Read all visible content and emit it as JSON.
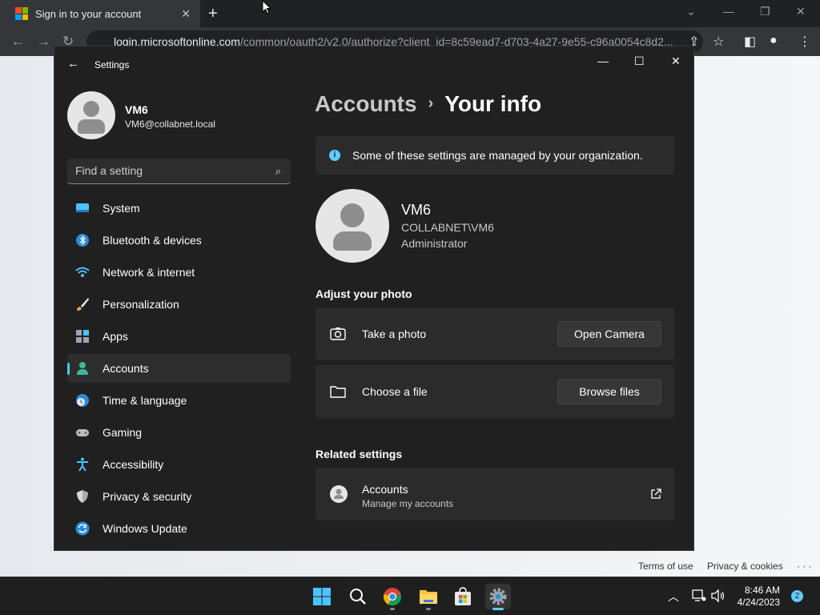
{
  "browser": {
    "tab_title": "Sign in to your account",
    "url_host": "login.microsoftonline.com",
    "url_path": "/common/oauth2/v2.0/authorize?client_id=8c59ead7-d703-4a27-9e55-c96a0054c8d2...",
    "footer_links": [
      "Terms of use",
      "Privacy & cookies",
      "· · ·"
    ]
  },
  "settings": {
    "window_title": "Settings",
    "profile": {
      "name": "VM6",
      "email": "VM6@collabnet.local"
    },
    "search_placeholder": "Find a setting",
    "nav": [
      {
        "label": "System",
        "icon": "system-icon"
      },
      {
        "label": "Bluetooth & devices",
        "icon": "bluetooth-icon"
      },
      {
        "label": "Network & internet",
        "icon": "wifi-icon"
      },
      {
        "label": "Personalization",
        "icon": "brush-icon"
      },
      {
        "label": "Apps",
        "icon": "apps-icon"
      },
      {
        "label": "Accounts",
        "icon": "accounts-icon",
        "active": true
      },
      {
        "label": "Time & language",
        "icon": "globe-clock-icon"
      },
      {
        "label": "Gaming",
        "icon": "gamepad-icon"
      },
      {
        "label": "Accessibility",
        "icon": "accessibility-icon"
      },
      {
        "label": "Privacy & security",
        "icon": "shield-icon"
      },
      {
        "label": "Windows Update",
        "icon": "update-icon"
      }
    ],
    "breadcrumb": {
      "parent": "Accounts",
      "separator": "›",
      "current": "Your info"
    },
    "banner": "Some of these settings are managed by your organization.",
    "user": {
      "name": "VM6",
      "domain": "COLLABNET\\VM6",
      "role": "Administrator"
    },
    "adjust_photo": {
      "title": "Adjust your photo",
      "take_photo_label": "Take a photo",
      "open_camera_button": "Open Camera",
      "choose_file_label": "Choose a file",
      "browse_files_button": "Browse files"
    },
    "related": {
      "title": "Related settings",
      "accounts_title": "Accounts",
      "accounts_sub": "Manage my accounts"
    }
  },
  "taskbar": {
    "time": "8:46 AM",
    "date": "4/24/2023",
    "notification_count": "2"
  },
  "colors": {
    "accent": "#60cdff",
    "window_bg": "#202020",
    "card_bg": "#2b2b2b"
  }
}
